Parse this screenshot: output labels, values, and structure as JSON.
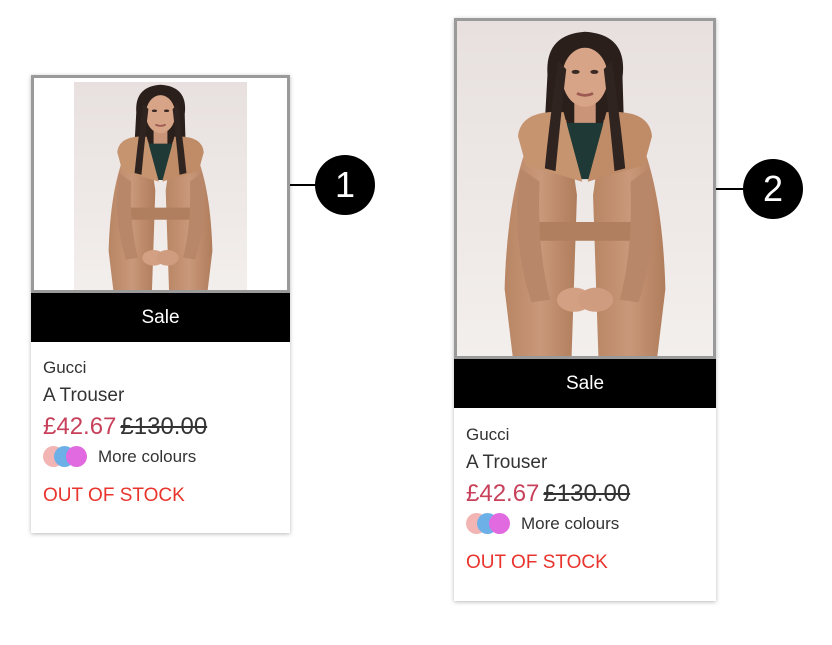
{
  "cards": [
    {
      "callout": "1",
      "sale_label": "Sale",
      "brand": "Gucci",
      "name": "A Trouser",
      "price_sale": "£42.67",
      "price_original": "£130.00",
      "colours_label": "More colours",
      "stock_status": "OUT OF STOCK"
    },
    {
      "callout": "2",
      "sale_label": "Sale",
      "brand": "Gucci",
      "name": "A Trouser",
      "price_sale": "£42.67",
      "price_original": "£130.00",
      "colours_label": "More colours",
      "stock_status": "OUT OF STOCK"
    }
  ],
  "swatch_colors": [
    "#f2b5b3",
    "#6db0e8",
    "#e26ae0"
  ],
  "colors": {
    "sale_price": "#c8415b",
    "out_of_stock": "#e9342d",
    "banner": "#000000",
    "image_border": "#9a9a9a"
  }
}
